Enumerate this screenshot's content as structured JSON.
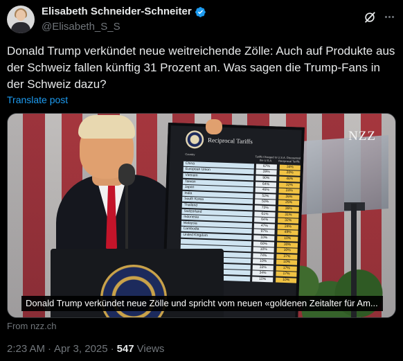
{
  "author": {
    "display_name": "Elisabeth Schneider-Schneiter",
    "handle": "@Elisabeth_S_S",
    "verified": true
  },
  "tweet": {
    "text": "Donald Trump verkündet neue weitreichende Zölle: Auch auf Produkte aus der Schweiz fallen künftig 31 Prozent an. Was sagen die Trump-Fans in der Schweiz dazu?",
    "translate_label": "Translate post"
  },
  "media": {
    "watermark": "NZZ",
    "caption": "Donald Trump verkündet neue Zölle und spricht vom neuen «goldenen Zeitalter für Am...",
    "board": {
      "title": "Reciprocal Tariffs",
      "columns": [
        "Country",
        "Tariffs Charged to the U.S.A.",
        "U.S.A. Discounted Reciprocal Tariffs"
      ],
      "rows": [
        {
          "country": "China",
          "charged": "67%",
          "reciprocal": "34%"
        },
        {
          "country": "European Union",
          "charged": "39%",
          "reciprocal": "20%"
        },
        {
          "country": "Vietnam",
          "charged": "90%",
          "reciprocal": "46%"
        },
        {
          "country": "Taiwan",
          "charged": "64%",
          "reciprocal": "32%"
        },
        {
          "country": "Japan",
          "charged": "46%",
          "reciprocal": "24%"
        },
        {
          "country": "India",
          "charged": "52%",
          "reciprocal": "26%"
        },
        {
          "country": "South Korea",
          "charged": "50%",
          "reciprocal": "25%"
        },
        {
          "country": "Thailand",
          "charged": "72%",
          "reciprocal": "36%"
        },
        {
          "country": "Switzerland",
          "charged": "61%",
          "reciprocal": "31%"
        },
        {
          "country": "Indonesia",
          "charged": "64%",
          "reciprocal": "32%"
        },
        {
          "country": "Malaysia",
          "charged": "47%",
          "reciprocal": "24%"
        },
        {
          "country": "Cambodia",
          "charged": "97%",
          "reciprocal": "49%"
        },
        {
          "country": "United Kingdom",
          "charged": "10%",
          "reciprocal": "10%"
        },
        {
          "country": "",
          "charged": "60%",
          "reciprocal": "30%"
        },
        {
          "country": "",
          "charged": "10%",
          "reciprocal": "10%"
        },
        {
          "country": "",
          "charged": "74%",
          "reciprocal": "37%"
        },
        {
          "country": "",
          "charged": "10%",
          "reciprocal": "10%"
        },
        {
          "country": "",
          "charged": "33%",
          "reciprocal": "17%"
        },
        {
          "country": "",
          "charged": "34%",
          "reciprocal": "17%"
        },
        {
          "country": "",
          "charged": "10%",
          "reciprocal": "10%"
        }
      ]
    }
  },
  "source": "From nzz.ch",
  "meta": {
    "time": "2:23 AM",
    "separator": "·",
    "date": "Apr 3, 2025",
    "views_count": "547",
    "views_label": "Views"
  },
  "colors": {
    "background": "#000000",
    "text": "#e7e9ea",
    "muted": "#71767b",
    "link": "#1d9bf0",
    "verified": "#1d9bf0"
  },
  "icons": [
    "avatar",
    "verified-badge-icon",
    "grok-icon",
    "more-icon"
  ]
}
